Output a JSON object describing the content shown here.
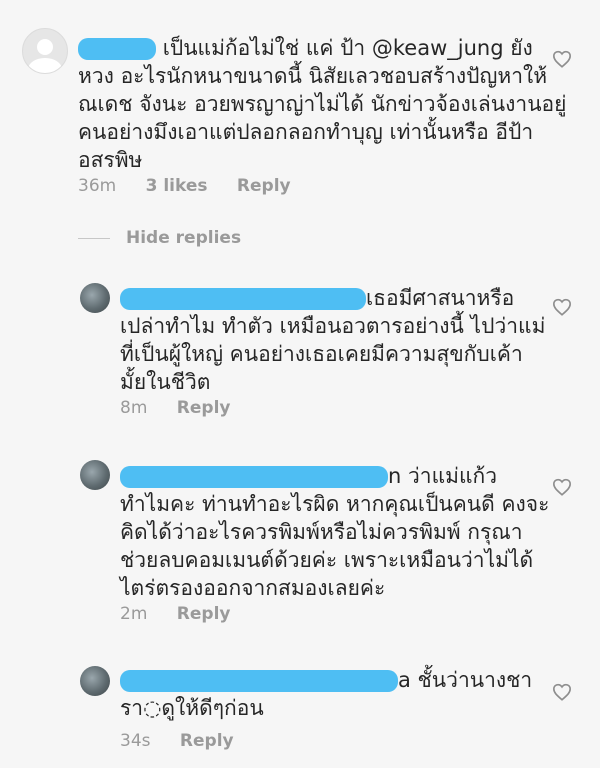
{
  "comments": [
    {
      "lines": [
        "เป็นแม่ก้อไม่ใช่ แค่ ป้า @keaw_jung ยัง",
        "หวง อะไรนักหนาขนาดนี้ นิสัยเลวชอบสร้างปัญหาให้",
        "ณเดช จังนะ อวยพรญาญ่าไม่ได้ นักข่าวจ้องเล่นงานอยู่",
        "คนอย่างมึงเอาแต่ปลอกลอกทำบุญ เท่านั้นหรือ อีป้า",
        "อสรพิษ"
      ],
      "time": "36m",
      "likes": "3 likes",
      "reply": "Reply"
    },
    {
      "lines": [
        "เธอมีศาสนาหรือ",
        "เปล่าทำไม ทำตัว เหมือนอวตารอย่างนี้ ไปว่าแม่",
        "ที่เป็นผู้ใหญ่  คนอย่างเธอเคยมีความสุขกับเค้า",
        "มั้ยในชีวิต"
      ],
      "time": "8m",
      "reply": "Reply"
    },
    {
      "lines": [
        "n ว่าแม่แก้ว",
        "ทำไมคะ ท่านทำอะไรผิด หากคุณเป็นคนดี คงจะ",
        "คิดได้ว่าอะไรควรพิมพ์หรือไม่ควรพิมพ์ กรุณา",
        "ช่วยลบคอมเมนต์ด้วยค่ะ เพราะเหมือนว่าไม่ได้",
        "ไตร่ตรองออกจากสมองเลยค่ะ"
      ],
      "time": "2m",
      "reply": "Reply"
    },
    {
      "lines": [
        "a ชั้นว่านางชา",
        "รา◌ดูให้ดีๆก่อน"
      ],
      "time": "34s",
      "reply": "Reply"
    }
  ],
  "hide_replies": "Hide replies",
  "colors": {
    "redaction": "#3fb9f2",
    "meta": "#9a9a9a",
    "text": "#262626"
  },
  "icons": {
    "like": "heart-outline-icon",
    "avatar": "default-avatar-icon"
  }
}
